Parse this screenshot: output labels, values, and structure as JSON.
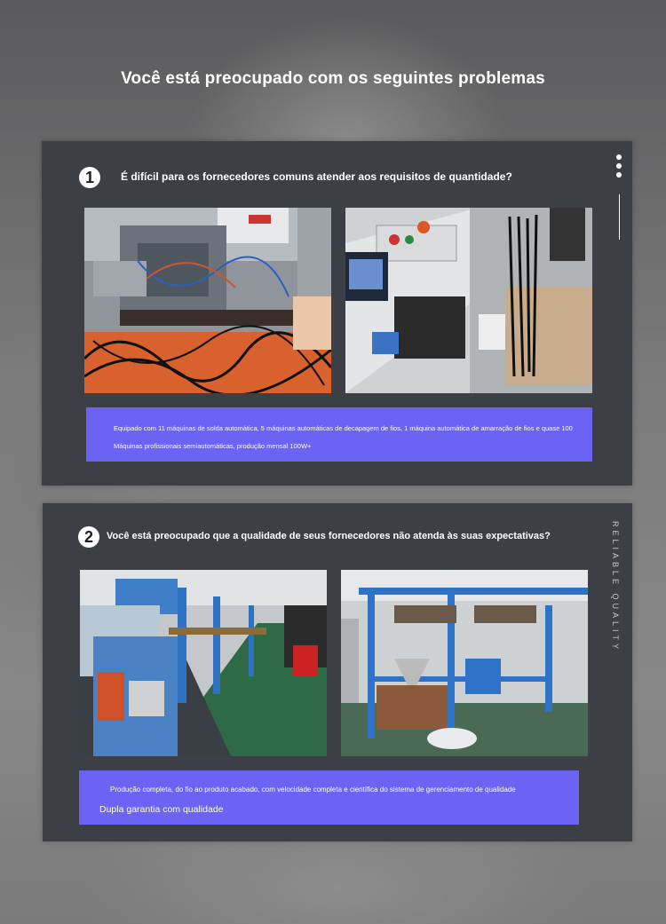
{
  "page": {
    "title": "Você está preocupado com os seguintes problemas"
  },
  "problem1": {
    "number": "1",
    "question": "É difícil para os fornecedores comuns atender aos requisitos de quantidade?",
    "caption_line1": "Equipado com 11 máquinas de solda automática, 5 máquinas automáticas de decapagem de fios, 1 máquina automática de amarração de fios e quase 100",
    "caption_line2": "Máquinas profissionais semiautomáticas, produção mensal 100W+"
  },
  "problem2": {
    "number": "2",
    "question": "Você está preocupado que a qualidade de seus fornecedores não atenda às suas expectativas?",
    "caption_line1": "Produção completa, do fio ao produto acabado, com velocidade completa e científica do sistema de gerenciamento de qualidade",
    "caption_line2": "Dupla garantia com qualidade",
    "side_text": "RELIABLE QUALITY"
  },
  "colors": {
    "panel": "#3d3f47",
    "accent": "#6a63f3",
    "text": "#ffffff"
  },
  "icons": [
    "menu-dots-icon"
  ]
}
